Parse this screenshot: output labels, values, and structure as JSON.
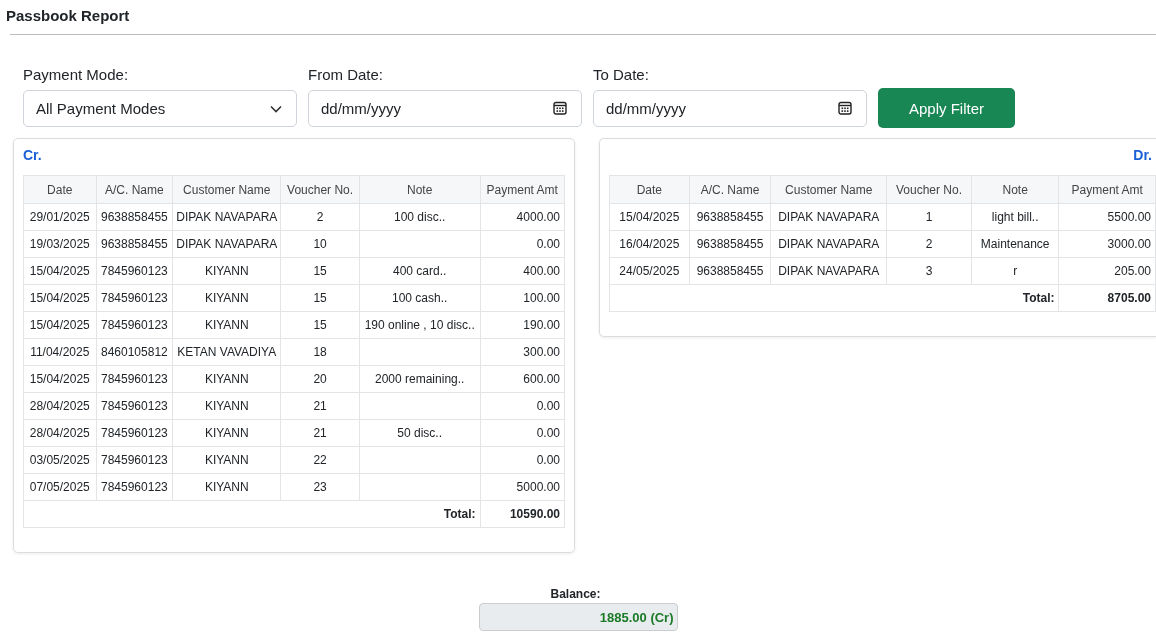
{
  "page_title": "Passbook Report",
  "filters": {
    "payment_mode": {
      "label": "Payment Mode:",
      "value": "All Payment Modes"
    },
    "from_date": {
      "label": "From Date:",
      "placeholder": "dd/mm/yyyy"
    },
    "to_date": {
      "label": "To Date:",
      "placeholder": "dd/mm/yyyy"
    },
    "apply_button": "Apply Filter"
  },
  "ledgers": [
    {
      "kind": "credit",
      "title": "Cr.",
      "columns": [
        "Date",
        "A/C. Name",
        "Customer Name",
        "Voucher No.",
        "Note",
        "Payment Amt"
      ],
      "rows": [
        [
          "29/01/2025",
          "9638858455",
          "DIPAK NAVAPARA",
          "2",
          "100 disc..",
          "4000.00"
        ],
        [
          "19/03/2025",
          "9638858455",
          "DIPAK NAVAPARA",
          "10",
          "",
          "0.00"
        ],
        [
          "15/04/2025",
          "7845960123",
          "KIYANN",
          "15",
          "400 card..",
          "400.00"
        ],
        [
          "15/04/2025",
          "7845960123",
          "KIYANN",
          "15",
          "100 cash..",
          "100.00"
        ],
        [
          "15/04/2025",
          "7845960123",
          "KIYANN",
          "15",
          "190 online , 10 disc..",
          "190.00"
        ],
        [
          "11/04/2025",
          "8460105812",
          "KETAN VAVADIYA",
          "18",
          "",
          "300.00"
        ],
        [
          "15/04/2025",
          "7845960123",
          "KIYANN",
          "20",
          "2000 remaining..",
          "600.00"
        ],
        [
          "28/04/2025",
          "7845960123",
          "KIYANN",
          "21",
          "",
          "0.00"
        ],
        [
          "28/04/2025",
          "7845960123",
          "KIYANN",
          "21",
          "50 disc..",
          "0.00"
        ],
        [
          "03/05/2025",
          "7845960123",
          "KIYANN",
          "22",
          "",
          "0.00"
        ],
        [
          "07/05/2025",
          "7845960123",
          "KIYANN",
          "23",
          "",
          "5000.00"
        ]
      ],
      "total_label": "Total:",
      "total": "10590.00"
    },
    {
      "kind": "debit",
      "title": "Dr.",
      "columns": [
        "Date",
        "A/C. Name",
        "Customer Name",
        "Voucher No.",
        "Note",
        "Payment Amt"
      ],
      "rows": [
        [
          "15/04/2025",
          "9638858455",
          "DIPAK NAVAPARA",
          "1",
          "light bill..",
          "5500.00"
        ],
        [
          "16/04/2025",
          "9638858455",
          "DIPAK NAVAPARA",
          "2",
          "Maintenance",
          "3000.00"
        ],
        [
          "24/05/2025",
          "9638858455",
          "DIPAK NAVAPARA",
          "3",
          "r",
          "205.00"
        ]
      ],
      "total_label": "Total:",
      "total": "8705.00"
    }
  ],
  "balance": {
    "label": "Balance:",
    "value": "1885.00 (Cr)"
  }
}
